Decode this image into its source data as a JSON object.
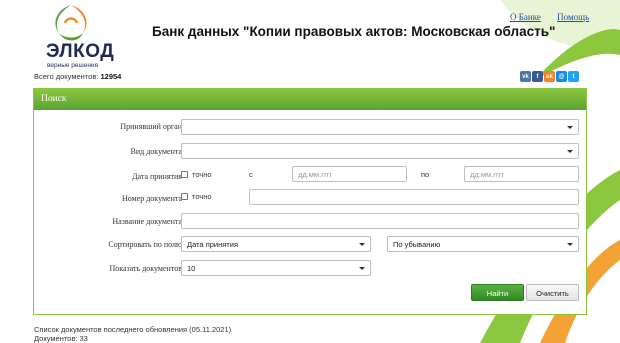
{
  "logo": {
    "name": "ЭЛКОД",
    "tagline": "верные решения"
  },
  "header": {
    "title": "Банк данных \"Копии правовых актов: Московская область\"",
    "links": [
      "О Банке",
      "Помощь"
    ]
  },
  "stats": {
    "total_label": "Всего документов:",
    "total_value": "12954"
  },
  "social": [
    {
      "icon": "vk-icon",
      "glyph": "vk",
      "color": "#4a76a8"
    },
    {
      "icon": "facebook-icon",
      "glyph": "f",
      "color": "#3b5998"
    },
    {
      "icon": "odnoklassniki-icon",
      "glyph": "ok",
      "color": "#f58220"
    },
    {
      "icon": "moimir-icon",
      "glyph": "@",
      "color": "#168de2"
    },
    {
      "icon": "twitter-icon",
      "glyph": "t",
      "color": "#1da1f2"
    }
  ],
  "search": {
    "title": "Поиск",
    "issuer_label": "Принявший орган",
    "issuer_value": "",
    "doctype_label": "Вид документа",
    "doctype_value": "",
    "date_label": "Дата принятия",
    "exact_label": "точно",
    "from_label": "с",
    "to_label": "по",
    "date_placeholder": "дд.мм.гггг",
    "number_label": "Номер документа",
    "name_label": "Название документа",
    "sort_label": "Сортировать по полю",
    "sort_field_value": "Дата принятия",
    "sort_order_value": "По убыванию",
    "show_label": "Показать документов",
    "show_value": "10",
    "find_button": "Найти",
    "clear_button": "Очистить"
  },
  "footer": {
    "last_update": "Список документов последнего обновления (05.11.2021)",
    "count": "Документов: 33"
  },
  "colors": {
    "accent": "#5aa332",
    "brand_dark": "#1e2a55",
    "link": "#1a4f99"
  }
}
